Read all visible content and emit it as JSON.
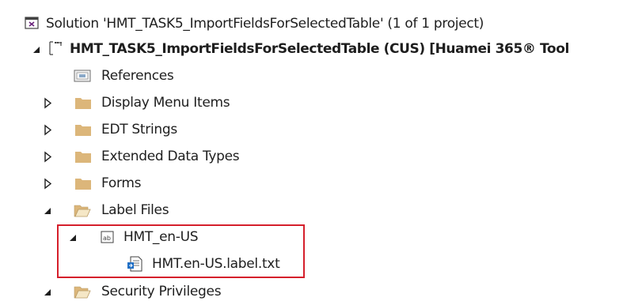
{
  "solution_explorer": {
    "solution": {
      "label": "Solution 'HMT_TASK5_ImportFieldsForSelectedTable' (1 of 1 project)",
      "icon": "solution-icon"
    },
    "project": {
      "label": "HMT_TASK5_ImportFieldsForSelectedTable (CUS) [Huamei 365® Tool",
      "icon": "project-icon",
      "expanded": true
    },
    "items": [
      {
        "label": "References",
        "icon": "references-icon"
      },
      {
        "label": "Display Menu Items",
        "icon": "folder-icon",
        "expanded": false
      },
      {
        "label": "EDT Strings",
        "icon": "folder-icon",
        "expanded": false
      },
      {
        "label": "Extended Data Types",
        "icon": "folder-icon",
        "expanded": false
      },
      {
        "label": "Forms",
        "icon": "folder-icon",
        "expanded": false
      },
      {
        "label": "Label Files",
        "icon": "open-folder-icon",
        "expanded": true
      },
      {
        "label": "HMT_en-US",
        "icon": "label-file-icon",
        "expanded": true
      },
      {
        "label": "HMT.en-US.label.txt",
        "icon": "text-file-icon"
      },
      {
        "label": "Security Privileges",
        "icon": "open-folder-icon",
        "expanded": true
      }
    ]
  },
  "colors": {
    "folder": "#dcb67a",
    "highlight_border": "#d51f2b",
    "chevron": "#1e1e1e",
    "text": "#1e1e1e"
  }
}
